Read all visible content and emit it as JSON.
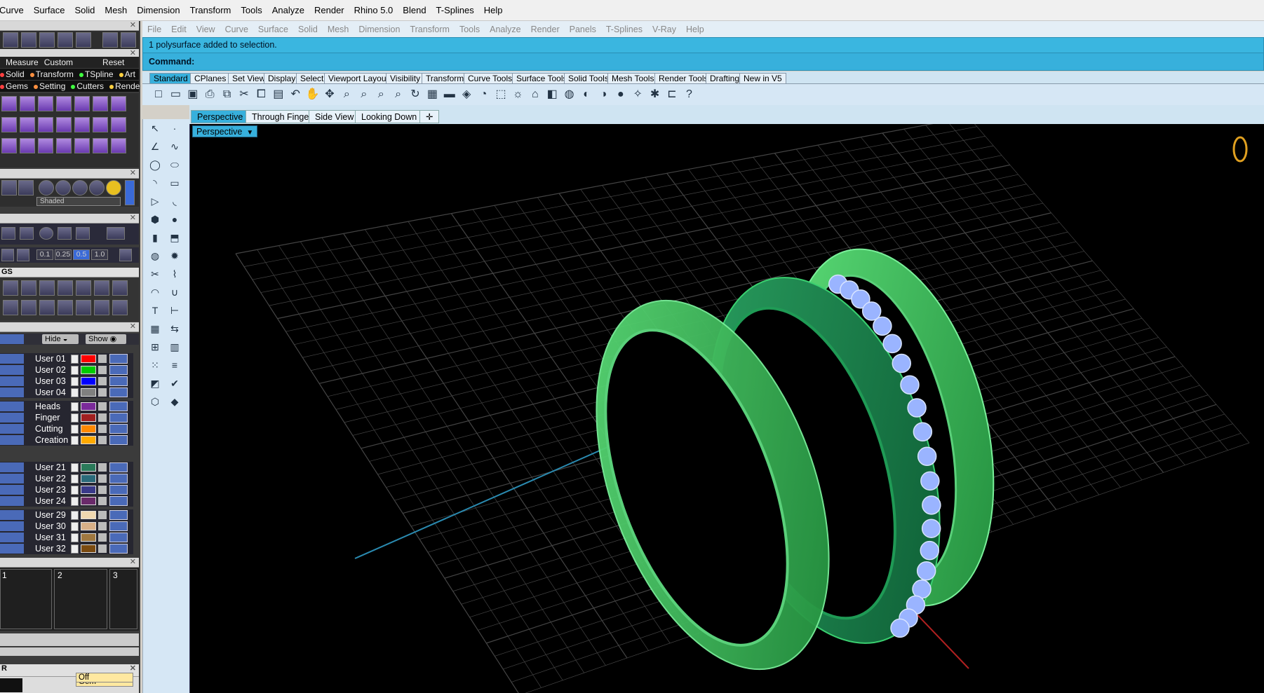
{
  "menu": [
    "Curve",
    "Surface",
    "Solid",
    "Mesh",
    "Dimension",
    "Transform",
    "Tools",
    "Analyze",
    "Render",
    "Rhino 5.0",
    "Blend",
    "T-Splines",
    "Help"
  ],
  "menu2": [
    "File",
    "Edit",
    "View",
    "Curve",
    "Surface",
    "Solid",
    "Mesh",
    "Dimension",
    "Transform",
    "Tools",
    "Analyze",
    "Render",
    "Panels",
    "T-Splines",
    "V-Ray",
    "Help"
  ],
  "command": {
    "history": "1 polysurface added to selection.",
    "prompt": "Command:"
  },
  "toolbar_tabs": [
    "Standard",
    "CPlanes",
    "Set View",
    "Display",
    "Select",
    "Viewport Layout",
    "Visibility",
    "Transform",
    "Curve Tools",
    "Surface Tools",
    "Solid Tools",
    "Mesh Tools",
    "Render Tools",
    "Drafting",
    "New in V5"
  ],
  "viewport_tabs": [
    "Perspective",
    "Through Finger",
    "Side View",
    "Looking Down"
  ],
  "viewport_label": "Perspective",
  "left_panel": {
    "measure_row": {
      "measure": "Measure",
      "custom": "Custom",
      "reset": "Reset"
    },
    "plugin_row1": [
      "Solid",
      "Transform",
      "TSpline",
      "Art"
    ],
    "plugin_row2": [
      "Gems",
      "Setting",
      "Cutters",
      "Render"
    ],
    "display_mode": "Shaded",
    "snap_values": [
      "0.1",
      "0.25",
      "0.5",
      "1.0"
    ],
    "gs_title": "GS",
    "hide_label": "Hide",
    "show_label": "Show",
    "layers": [
      {
        "name": "User 01",
        "color": "#ff0000"
      },
      {
        "name": "User 02",
        "color": "#00cc00"
      },
      {
        "name": "User 03",
        "color": "#0000ff"
      },
      {
        "name": "User 04",
        "color": "#808080"
      },
      {
        "name": "Heads",
        "color": "#7a2a9a"
      },
      {
        "name": "Finger",
        "color": "#a02020"
      },
      {
        "name": "Cutting",
        "color": "#ff8800"
      },
      {
        "name": "Creation",
        "color": "#ffaa00"
      },
      {
        "name": "User 21",
        "color": "#2a7a5a"
      },
      {
        "name": "User 22",
        "color": "#2a6a7a"
      },
      {
        "name": "User 23",
        "color": "#3a3a8a"
      },
      {
        "name": "User 24",
        "color": "#6a2a6a"
      },
      {
        "name": "User 29",
        "color": "#f0d8b0"
      },
      {
        "name": "User 30",
        "color": "#d8b088"
      },
      {
        "name": "User 31",
        "color": "#a07840"
      },
      {
        "name": "User 32",
        "color": "#7a4a10"
      }
    ],
    "pages": [
      "1",
      "2",
      "3"
    ],
    "bottom_title": "R",
    "gem_field": "Gem",
    "off_field": "Off"
  },
  "colors": {
    "accent": "#37b0dc",
    "ring_green": "#3fbf5a",
    "gem_blue": "#9ab4ff",
    "grid": "#444444"
  }
}
